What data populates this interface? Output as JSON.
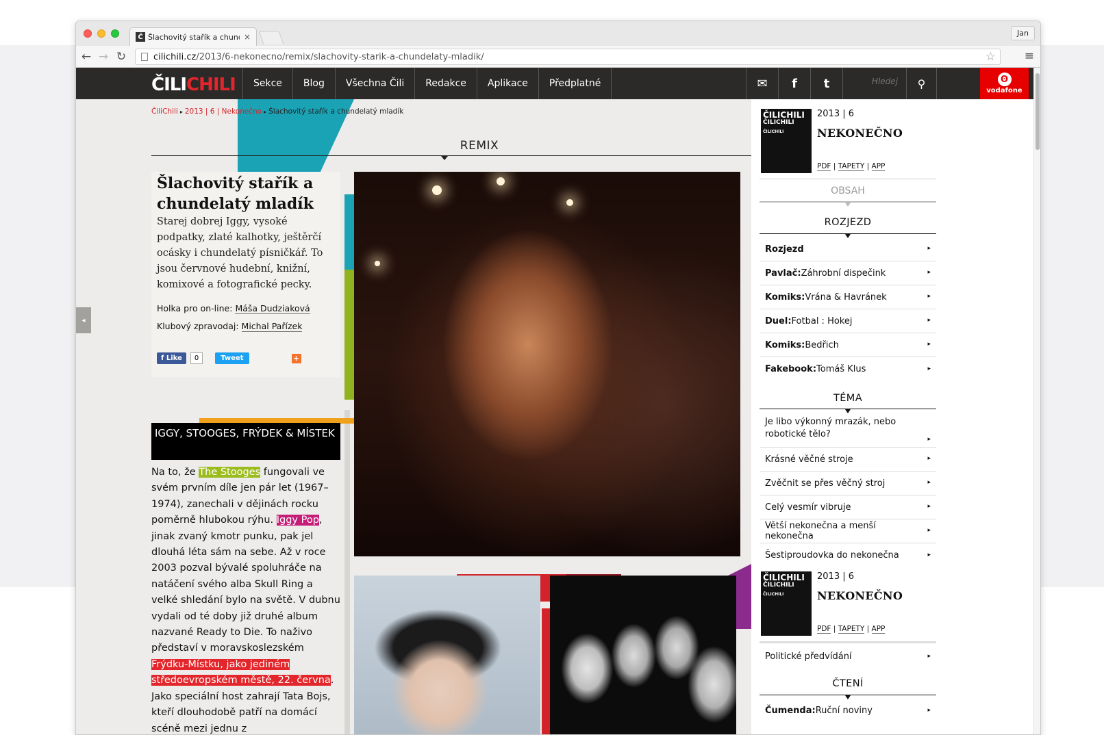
{
  "browser": {
    "tab_title": "Šlachovitý stařík a chundelatý mladík",
    "favicon_letter": "Č",
    "tab_close": "×",
    "profile_name": "Jan",
    "url_host": "cilichili.cz",
    "url_path": "/2013/6-nekonecno/remix/slachovity-starik-a-chundelaty-mladik/",
    "icons": {
      "back": "←",
      "forward": "→",
      "reload": "↻",
      "star": "☆",
      "menu": "≡"
    }
  },
  "site": {
    "logo_white": "ČILI",
    "logo_red": "CHILI",
    "nav": [
      "Sekce",
      "Blog",
      "Všechna Čili",
      "Redakce",
      "Aplikace",
      "Předplatné"
    ],
    "social_icons": [
      "newsletter-icon",
      "facebook-icon",
      "twitter-icon"
    ],
    "social_glyphs": {
      "newsletter": "✉",
      "facebook": "f",
      "twitter": "t"
    },
    "search_placeholder": "Hledej",
    "search_glyph": "⚲",
    "sponsor": "vodafone",
    "sponsor_glyph": "ʘ",
    "colors": {
      "brand_red": "#e3262b",
      "nav_bg": "#2b2a29",
      "teal": "#1aa2b5",
      "green": "#8fb31f",
      "magenta": "#c51e78"
    }
  },
  "breadcrumb": {
    "home": "ČiliChili",
    "issue": "2013 | 6 | Nekonečno",
    "current": "Šlachovitý stařík a chundelatý mladík",
    "sep": "▸"
  },
  "section": {
    "title": "REMIX"
  },
  "article": {
    "title": "Šlachovitý stařík a chundelatý mladík",
    "lead": "Starej dobrej Iggy, vysoké podpatky, zlaté kalhotky, ještěrčí ocásky i chundelatý písničkář. To jsou červnové hudební, knižní, komixové a fotografické pecky.",
    "credit_1_label": "Holka pro on-line:",
    "credit_1_name": "Máša Dudziaková",
    "credit_2_label": "Klubový zpravodaj:",
    "credit_2_name": "Michal Pařízek",
    "share": {
      "like": "Like",
      "like_count": "0",
      "tweet": "Tweet",
      "plus": "+"
    },
    "box_heading": "IGGY, STOOGES, FRÝDEK & MÍSTEK",
    "body": {
      "p1": "Na to, že ",
      "hl1": "The Stooges",
      "p2": " fungovali ve svém prvním díle jen pár let (1967–1974), zanechali v dějinách rocku poměrně hlubokou rýhu. ",
      "hl2": "Iggy Pop",
      "p3": ", jinak zvaný kmotr punku, pak jel dlouhá léta sám na sebe. Až v roce 2003 pozval bývalé spoluhráče na natáčení svého alba Skull Ring a velké shledání bylo na světě. V dubnu vydali od té doby již druhé album nazvané Ready to Die. To naživo představí v moravskoslezském ",
      "hl3": "Frýdku-Místku, jako jediném středoevropském městě, 22. června",
      "p4": ". Jako speciální host zahrají Tata Bojs, kteří dlouhodobě patří na domácí scéně mezi jednu z nejprogresivnějších a nejoriginálnějších kapel."
    },
    "side_tab_glyph": "◂"
  },
  "sidebar": {
    "issue": {
      "cover_title": "ČILICHILI",
      "cover_sub": "ČILICHILI",
      "cover_sub2": "ČILICHILI",
      "meta": "2013 | 6",
      "name": "NEKONEČNO",
      "link_pdf": "PDF",
      "link_tapety": "TAPETY",
      "link_app": "APP",
      "sep": "|"
    },
    "obsah": "OBSAH",
    "chevron": "▸",
    "groups": {
      "rozjezd": {
        "title": "ROZJEZD",
        "items": [
          {
            "bold": "Rozjezd",
            "text": ""
          },
          {
            "bold": "Pavlač:",
            "text": " Záhrobní dispečink"
          },
          {
            "bold": "Komiks:",
            "text": " Vrána & Havránek"
          },
          {
            "bold": "Duel:",
            "text": " Fotbal : Hokej"
          },
          {
            "bold": "Komiks:",
            "text": " Bedřich"
          },
          {
            "bold": "Fakebook:",
            "text": " Tomáš Klus"
          }
        ]
      },
      "tema": {
        "title": "TÉMA",
        "items": [
          "Je libo výkonný mrazák, nebo robotické tělo?",
          "Krásné věčné stroje",
          "Zvěčnit se přes věčný stroj",
          "Celý vesmír vibruje",
          "Větší nekonečna a menší nekonečna",
          "Šestiproudovka do nekonečna"
        ]
      },
      "extra": {
        "items": [
          "Politické předvídání"
        ]
      },
      "cteni": {
        "title": "ČTENÍ",
        "items": [
          {
            "bold": "Čumenda:",
            "text": " Ruční noviny"
          }
        ]
      }
    }
  }
}
